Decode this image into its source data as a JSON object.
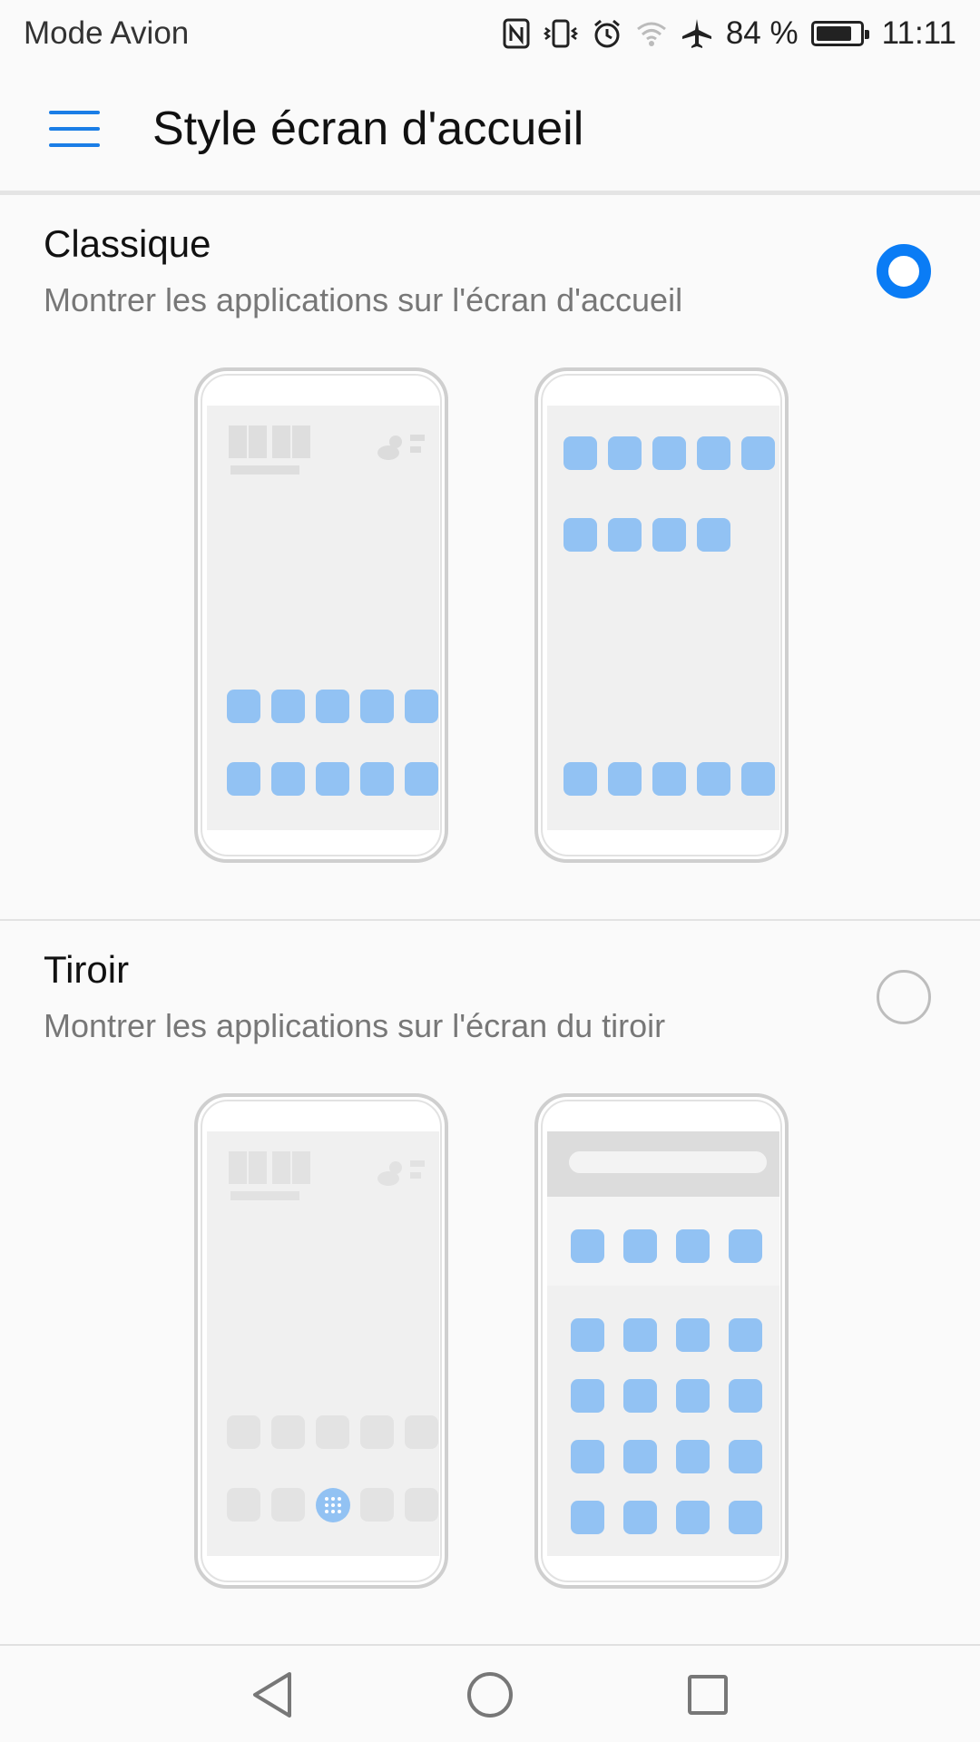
{
  "status_bar": {
    "left_text": "Mode Avion",
    "battery_percent": "84 %",
    "battery_level": 0.84,
    "time": "11:11",
    "icons": [
      "nfc-icon",
      "vibrate-icon",
      "alarm-icon",
      "wifi-icon",
      "airplane-icon",
      "battery-icon"
    ]
  },
  "header": {
    "menu_icon": "hamburger-menu-icon",
    "title": "Style écran d'accueil"
  },
  "options": [
    {
      "title": "Classique",
      "subtitle": "Montrer les applications sur l'écran d'accueil",
      "selected": true
    },
    {
      "title": "Tiroir",
      "subtitle": "Montrer les applications sur l'écran du tiroir",
      "selected": false
    }
  ],
  "colors": {
    "accent": "#0a7cf5",
    "menu_icon": "#1a7de6",
    "app_tile": "#92c2f3"
  },
  "nav_bar": {
    "icons": [
      "back-icon",
      "home-icon",
      "recents-icon"
    ]
  }
}
